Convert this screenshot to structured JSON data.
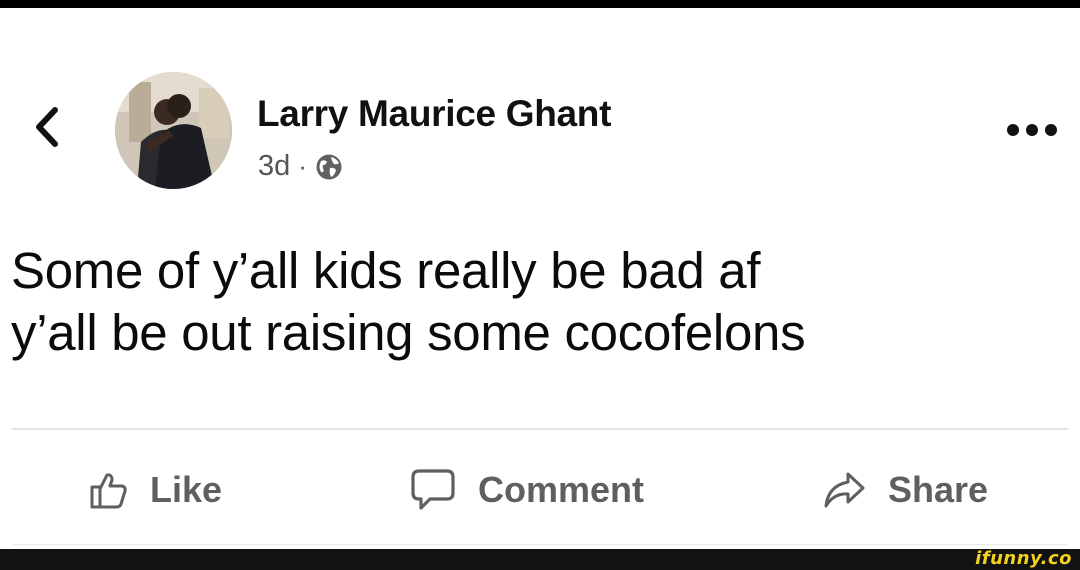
{
  "post": {
    "author": "Larry Maurice Ghant",
    "timestamp": "3d",
    "separator": "·",
    "privacy_icon": "globe-icon",
    "text_lines": [
      "Some of y’all kids really be bad af",
      "y’all be out raising some cocofelons"
    ]
  },
  "header": {
    "back_icon": "chevron-left-icon",
    "more_icon": "ellipsis-icon"
  },
  "actions": {
    "like_label": "Like",
    "comment_label": "Comment",
    "share_label": "Share"
  },
  "watermark": "ifunny.co",
  "colors": {
    "text": "#050505",
    "action_gray": "#5f5f5f",
    "divider": "#e4e4e4",
    "watermark": "#f2d21b"
  }
}
